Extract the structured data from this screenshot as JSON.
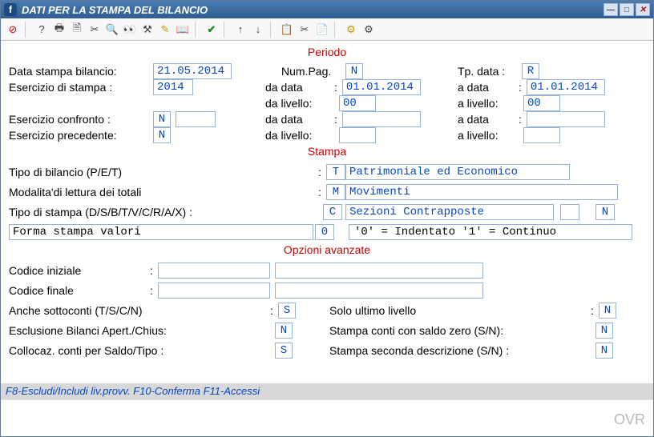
{
  "title": "DATI PER LA STAMPA DEL BILANCIO",
  "sections": {
    "periodo": "Periodo",
    "stampa": "Stampa",
    "avanzate": "Opzioni avanzate"
  },
  "periodo": {
    "data_stampa_bilancio_label": "Data stampa bilancio:",
    "data_stampa_bilancio_val": "21.05.2014",
    "num_pag_label": "Num.Pag.",
    "num_pag_val": "N",
    "tp_data_label": "Tp. data :",
    "tp_data_val": "R",
    "esercizio_stampa_label": "Esercizio di stampa :",
    "esercizio_stampa_val": "2014",
    "da_data_label": "da data",
    "da_data_val": "01.01.2014",
    "a_data_label": "a data",
    "a_data_val": "01.01.2014",
    "da_livello_label": "da livello:",
    "da_livello_val": "00",
    "a_livello_label": "a livello:",
    "a_livello_val": "00",
    "esercizio_confronto_label": "Esercizio confronto :",
    "esercizio_confronto_val": "N",
    "esercizio_confronto_anno": "",
    "conf_da_data": "",
    "conf_a_data": "",
    "conf_da_liv": "",
    "conf_a_liv": "",
    "esercizio_precedente_label": "Esercizio precedente:",
    "esercizio_precedente_val": "N",
    "prec_da_liv": "",
    "prec_a_liv": ""
  },
  "stampa": {
    "tipo_bilancio_label": "Tipo di bilancio (P/E/T)",
    "tipo_bilancio_val": "T",
    "tipo_bilancio_desc": "Patrimoniale ed Economico",
    "modalita_label": "Modalita'di lettura dei totali",
    "modalita_val": "M",
    "modalita_desc": "Movimenti",
    "tipo_stampa_label": "Tipo di stampa (D/S/B/T/V/C/R/A/X) :",
    "tipo_stampa_val": "C",
    "tipo_stampa_desc": "Sezioni Contrapposte",
    "tipo_stampa_extra1": "",
    "tipo_stampa_extra2": "N",
    "forma_label": "Forma stampa valori",
    "forma_val": "0",
    "forma_hint": "'0' = Indentato   '1' = Continuo"
  },
  "avanzate": {
    "codice_iniziale_label": "Codice iniziale",
    "codice_iniziale_val": "",
    "codice_iniziale_desc": "",
    "codice_finale_label": "Codice finale",
    "codice_finale_val": "",
    "codice_finale_desc": "",
    "anche_sottoconti_label": "Anche sottoconti (T/S/C/N)",
    "anche_sottoconti_val": "S",
    "solo_ultimo_label": "Solo ultimo livello",
    "solo_ultimo_val": "N",
    "esclusione_label": "Esclusione Bilanci Apert./Chius:",
    "esclusione_val": "N",
    "saldo_zero_label": "Stampa conti con saldo zero (S/N):",
    "saldo_zero_val": "N",
    "collocaz_label": "Collocaz. conti per Saldo/Tipo :",
    "collocaz_val": "S",
    "seconda_desc_label": "Stampa seconda descrizione (S/N) :",
    "seconda_desc_val": "N"
  },
  "footer": {
    "hint": "F8-Escludi/Includi liv.provv. F10-Conferma F11-Accessi",
    "ovr": "OVR"
  }
}
